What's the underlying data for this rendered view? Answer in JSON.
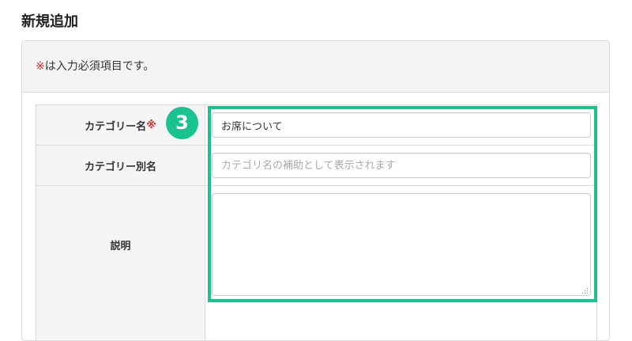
{
  "page_title": "新規追加",
  "notice": {
    "mark": "※",
    "text": "は入力必須項目です。"
  },
  "fields": [
    {
      "label": "カテゴリー名",
      "required_mark": "※",
      "value": "お席について",
      "placeholder": ""
    },
    {
      "label": "カテゴリー別名",
      "value": "",
      "placeholder": "カテゴリ名の補助として表示されます"
    },
    {
      "label": "説明",
      "value": "",
      "placeholder": ""
    }
  ],
  "annotation": {
    "step_number": "3",
    "color": "#18c38f"
  },
  "colors": {
    "required": "#c9302c",
    "panel_heading_bg": "#f4f4f4",
    "label_bg": "#f5f5f5",
    "highlight": "#18c38f"
  }
}
